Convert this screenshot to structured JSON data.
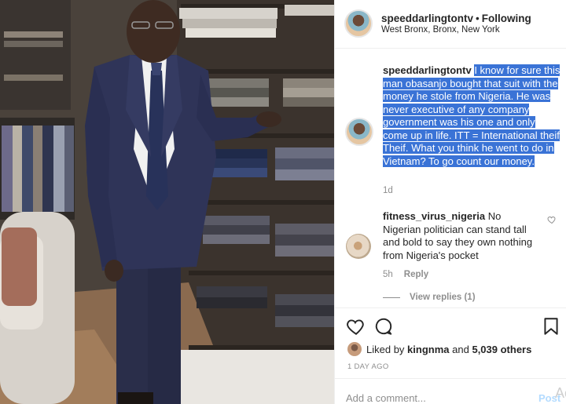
{
  "post": {
    "username": "speeddarlingtontv",
    "separator": "•",
    "follow_status": "Following",
    "location": "West Bronx, Bronx, New York"
  },
  "caption": {
    "username": "speeddarlingtontv",
    "text": "I know for sure this man obasanjo bought that suit with the money he stole from Nigeria. He was never executive of any company government was his one and only come up in life. ITT = International theif Theif. What you think he went to do in Vietnam? To go count our money.",
    "age": "1d"
  },
  "comment": {
    "username": "fitness_virus_nigeria",
    "text": "No Nigerian politician can stand tall and bold to say they own nothing from Nigeria's pocket",
    "age": "5h",
    "reply_label": "Reply",
    "view_replies": "View replies (1)"
  },
  "likes": {
    "prefix": "Liked by",
    "user": "kingnma",
    "conjunction": "and",
    "others": "5,039 others"
  },
  "date": "1 DAY AGO",
  "add_comment": {
    "placeholder": "Add a comment...",
    "post_label": "Post",
    "ghost_text": "Ac"
  },
  "icons": {
    "heart": "heart-icon",
    "comment": "comment-icon",
    "bookmark": "bookmark-icon",
    "comment_like": "heart-icon"
  },
  "colors": {
    "highlight": "#3a73d6",
    "muted": "#8e8e8e",
    "post_disabled": "#b3dbff"
  }
}
